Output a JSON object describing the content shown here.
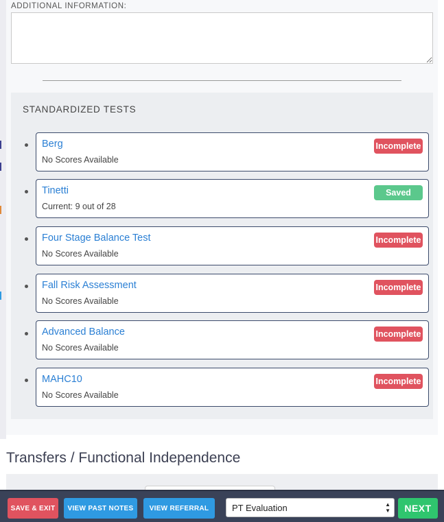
{
  "additional_info": {
    "label": "ADDITIONAL INFORMATION:",
    "value": ""
  },
  "standardized_tests": {
    "title": "STANDARDIZED TESTS",
    "items": [
      {
        "name": "Berg",
        "detail": "No Scores Available",
        "status": "Incomplete",
        "status_color": "#e0535f"
      },
      {
        "name": "Tinetti",
        "detail": "Current: 9 out of 28",
        "status": "Saved",
        "status_color": "#5bc88c"
      },
      {
        "name": "Four Stage Balance Test",
        "detail": "No Scores Available",
        "status": "Incomplete",
        "status_color": "#e0535f"
      },
      {
        "name": "Fall Risk Assessment",
        "detail": "No Scores Available",
        "status": "Incomplete",
        "status_color": "#e0535f"
      },
      {
        "name": "Advanced Balance",
        "detail": "No Scores Available",
        "status": "Incomplete",
        "status_color": "#e0535f"
      },
      {
        "name": "MAHC10",
        "detail": "No Scores Available",
        "status": "Incomplete",
        "status_color": "#e0535f"
      }
    ]
  },
  "section": {
    "heading": "Transfers / Functional Independence"
  },
  "bottom_bar": {
    "save_exit_label": "SAVE & EXIT",
    "view_past_notes_label": "VIEW PAST NOTES",
    "view_referral_label": "VIEW REFERRAL",
    "note_type_selected": "PT Evaluation",
    "next_label": "NEXT"
  },
  "colors": {
    "incomplete": "#e0535f",
    "saved": "#5bc88c",
    "link": "#2a7fd4",
    "bar": "#3a4258"
  }
}
